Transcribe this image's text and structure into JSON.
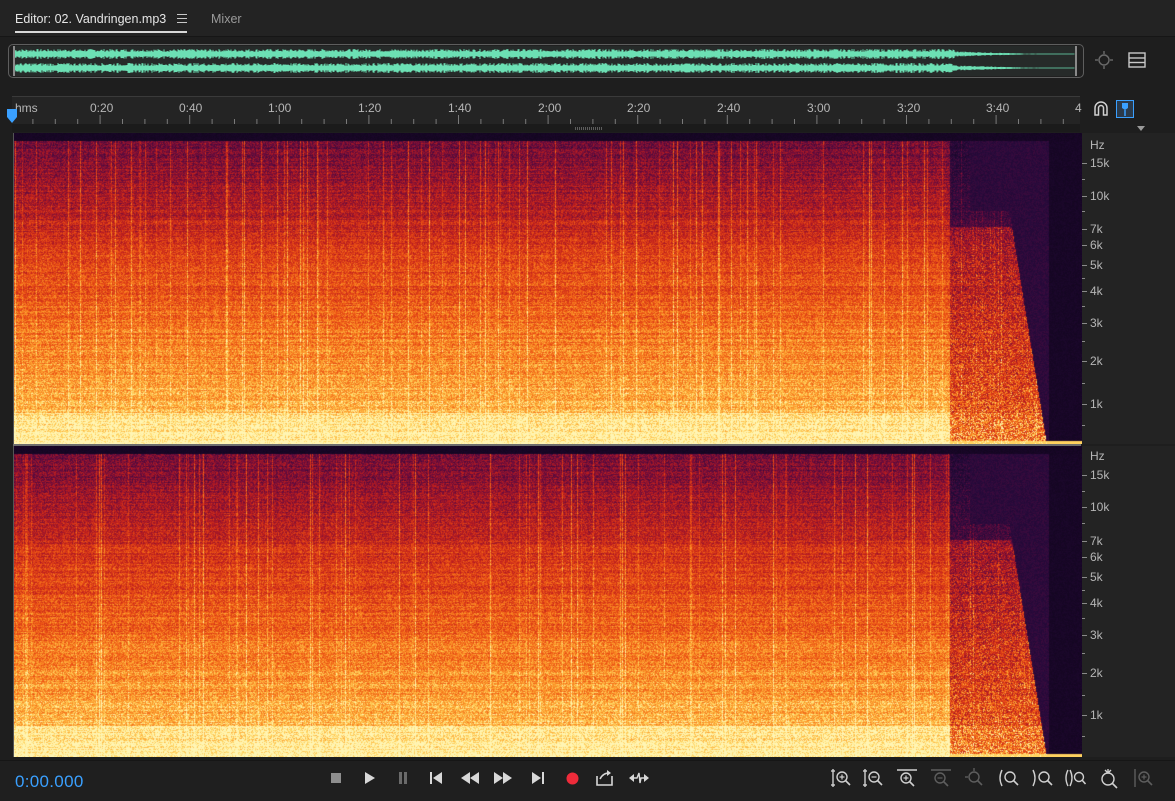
{
  "tabs": [
    {
      "label": "Editor: 02. Vandringen.mp3",
      "active": true
    },
    {
      "label": "Mixer",
      "active": false
    }
  ],
  "ruler": {
    "unit_label": "hms",
    "labels": [
      "0:20",
      "0:40",
      "1:00",
      "1:20",
      "1:40",
      "2:00",
      "2:20",
      "2:40",
      "3:00",
      "3:20",
      "3:40",
      "4"
    ]
  },
  "frequency_axis": {
    "unit": "Hz",
    "labels": [
      "15k",
      "10k",
      "7k",
      "6k",
      "5k",
      "4k",
      "3k",
      "2k",
      "1k"
    ]
  },
  "transport": {
    "current_time": "0:00.000",
    "buttons": [
      "stop",
      "play",
      "pause",
      "move-to-previous",
      "rewind",
      "fast-forward",
      "move-to-next",
      "record",
      "skip-selection",
      "loop"
    ]
  },
  "zoom_tools": [
    "zoom-in-amplitude",
    "zoom-out-amplitude",
    "zoom-in-time",
    "zoom-out-full",
    "zoom-in-at-playhead",
    "zoom-out-at-playhead",
    "zoom-to-selection",
    "zoom-in-left-edge",
    "zoom-in-right-edge",
    "zoom-out-full-both"
  ],
  "colors": {
    "accent": "#3aa0ff",
    "waveform": "#6ce0b4",
    "spectral_low": "#140626",
    "spectral_mid": "#d6301a",
    "spectral_high": "#ffd86a"
  }
}
